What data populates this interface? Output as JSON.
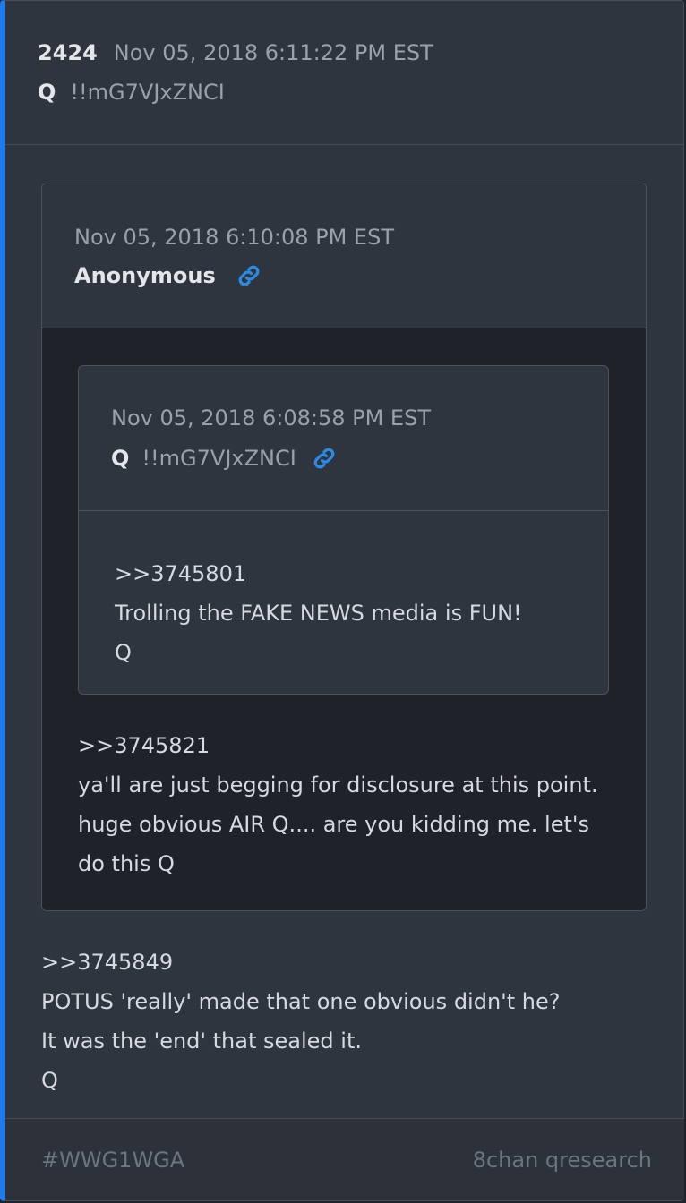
{
  "post": {
    "number": "2424",
    "timestamp": "Nov 05, 2018 6:11:22 PM EST",
    "author": "Q",
    "tripcode": "!!mG7VJxZNCI",
    "body": [
      ">>3745849",
      "POTUS 'really' made that one obvious didn't he?",
      "It was the 'end' that sealed it.",
      "Q"
    ]
  },
  "quote_outer": {
    "timestamp": "Nov 05, 2018 6:10:08 PM EST",
    "author": "Anonymous",
    "link_icon": "link-icon",
    "body": [
      ">>3745821",
      "ya'll are just begging for disclosure at this point.",
      "huge obvious AIR Q.... are you kidding me. let's",
      "do this Q"
    ]
  },
  "quote_inner": {
    "timestamp": "Nov 05, 2018 6:08:58 PM EST",
    "author": "Q",
    "tripcode": "!!mG7VJxZNCI",
    "link_icon": "link-icon",
    "body": [
      ">>3745801",
      "Trolling the FAKE NEWS media is FUN!",
      "Q"
    ]
  },
  "footer": {
    "tag": "#WWG1WGA",
    "source": "8chan qresearch"
  },
  "colors": {
    "accent": "#1f7aeb",
    "link": "#2a8be4",
    "card_bg": "#2f353f",
    "quote_bg": "#1f2229"
  }
}
